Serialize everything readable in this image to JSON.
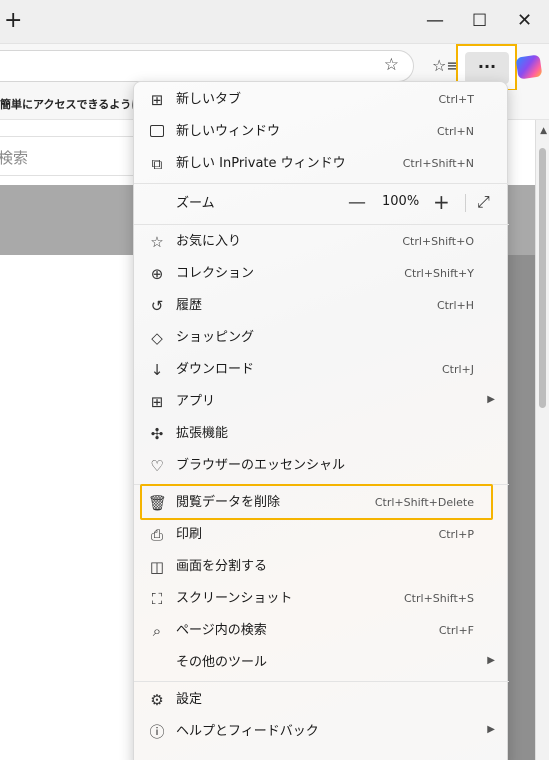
{
  "titlebar": {
    "new_tab_glyph": "+",
    "minimize_glyph": "—",
    "maximize_glyph": "☐",
    "close_glyph": "✕"
  },
  "toolbar": {
    "favorite_star_glyph": "☆",
    "favorites_glyph": "☆≡",
    "more_glyph": "···"
  },
  "favorites_bar": {
    "text": "簡単にアクセスできるようにな"
  },
  "page": {
    "search_text": "検索"
  },
  "menu": {
    "new_tab": {
      "label": "新しいタブ",
      "shortcut": "Ctrl+T",
      "icon": "new-tab-icon"
    },
    "new_window": {
      "label": "新しいウィンドウ",
      "shortcut": "Ctrl+N",
      "icon": "new-window-icon"
    },
    "new_inprivate": {
      "label": "新しい InPrivate ウィンドウ",
      "shortcut": "Ctrl+Shift+N",
      "icon": "inprivate-icon"
    },
    "zoom": {
      "label": "ズーム",
      "value": "100%",
      "minus": "—",
      "plus": "+",
      "fullscreen": "⤢"
    },
    "favorites": {
      "label": "お気に入り",
      "shortcut": "Ctrl+Shift+O",
      "icon": "favorites-icon"
    },
    "collections": {
      "label": "コレクション",
      "shortcut": "Ctrl+Shift+Y",
      "icon": "collections-icon"
    },
    "history": {
      "label": "履歴",
      "shortcut": "Ctrl+H",
      "icon": "history-icon"
    },
    "shopping": {
      "label": "ショッピング",
      "icon": "shopping-tag-icon"
    },
    "downloads": {
      "label": "ダウンロード",
      "shortcut": "Ctrl+J",
      "icon": "download-icon"
    },
    "apps": {
      "label": "アプリ",
      "icon": "apps-icon"
    },
    "extensions": {
      "label": "拡張機能",
      "icon": "extensions-icon"
    },
    "browser_essentials": {
      "label": "ブラウザーのエッセンシャル",
      "icon": "heart-pulse-icon"
    },
    "delete_browsing_data": {
      "label": "閲覧データを削除",
      "shortcut": "Ctrl+Shift+Delete",
      "icon": "trash-icon"
    },
    "print": {
      "label": "印刷",
      "shortcut": "Ctrl+P",
      "icon": "print-icon"
    },
    "split_screen": {
      "label": "画面を分割する",
      "icon": "split-screen-icon"
    },
    "screenshot": {
      "label": "スクリーンショット",
      "shortcut": "Ctrl+Shift+S",
      "icon": "screenshot-icon"
    },
    "find_on_page": {
      "label": "ページ内の検索",
      "shortcut": "Ctrl+F",
      "icon": "find-page-icon"
    },
    "more_tools": {
      "label": "その他のツール"
    },
    "settings": {
      "label": "設定",
      "icon": "gear-icon"
    },
    "help_feedback": {
      "label": "ヘルプとフィードバック",
      "icon": "help-icon"
    }
  },
  "colors": {
    "highlight": "#f5b400"
  }
}
